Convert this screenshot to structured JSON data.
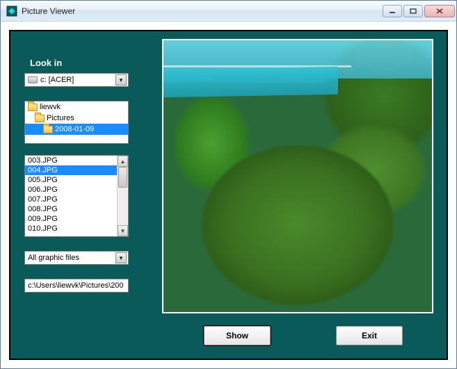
{
  "window": {
    "title": "Picture Viewer"
  },
  "panel": {
    "look_in_label": "Look in",
    "drive": {
      "text": "c: [ACER]"
    },
    "dirs": [
      {
        "name": "liewvk",
        "depth": 0,
        "selected": false
      },
      {
        "name": "Pictures",
        "depth": 1,
        "selected": false
      },
      {
        "name": "2008-01-09",
        "depth": 2,
        "selected": true
      }
    ],
    "files": [
      {
        "name": "003.JPG",
        "selected": false
      },
      {
        "name": "004.JPG",
        "selected": true
      },
      {
        "name": "005.JPG",
        "selected": false
      },
      {
        "name": "006.JPG",
        "selected": false
      },
      {
        "name": "007.JPG",
        "selected": false
      },
      {
        "name": "008.JPG",
        "selected": false
      },
      {
        "name": "009.JPG",
        "selected": false
      },
      {
        "name": "010.JPG",
        "selected": false
      }
    ],
    "filter": {
      "text": "All graphic files"
    },
    "path": {
      "value": "c:\\Users\\liewvk\\Pictures\\200"
    },
    "buttons": {
      "show": "Show",
      "exit": "Exit"
    }
  }
}
